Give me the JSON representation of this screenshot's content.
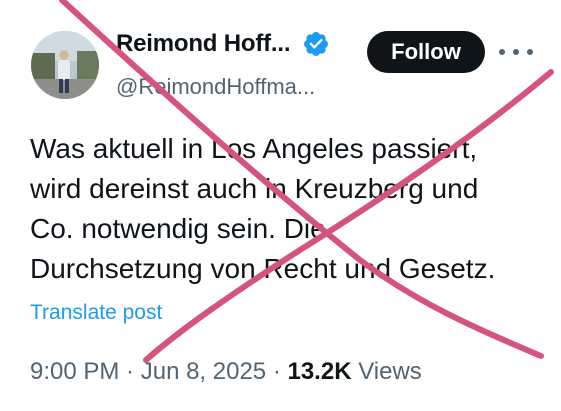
{
  "author": {
    "display_name": "Reimond Hoff...",
    "handle": "@ReimondHoffma..."
  },
  "follow_label": "Follow",
  "post": {
    "lines": [
      "Was aktuell in Los Angeles passiert,",
      "wird dereinst auch in Kreuzberg und",
      "Co. notwendig sein. Die",
      "Durchsetzung von Recht und Gesetz."
    ],
    "translate_label": "Translate post"
  },
  "meta": {
    "time": "9:00 PM",
    "separator1": " · ",
    "date": "Jun 8, 2025",
    "separator2": " · ",
    "views_count": "13.2K",
    "views_label": " Views"
  },
  "colors": {
    "verified": "#1d9bf0",
    "cross": "#d4547e",
    "link": "#1d9bf0"
  },
  "icons": [
    "verified-badge-icon",
    "more-options-icon"
  ]
}
